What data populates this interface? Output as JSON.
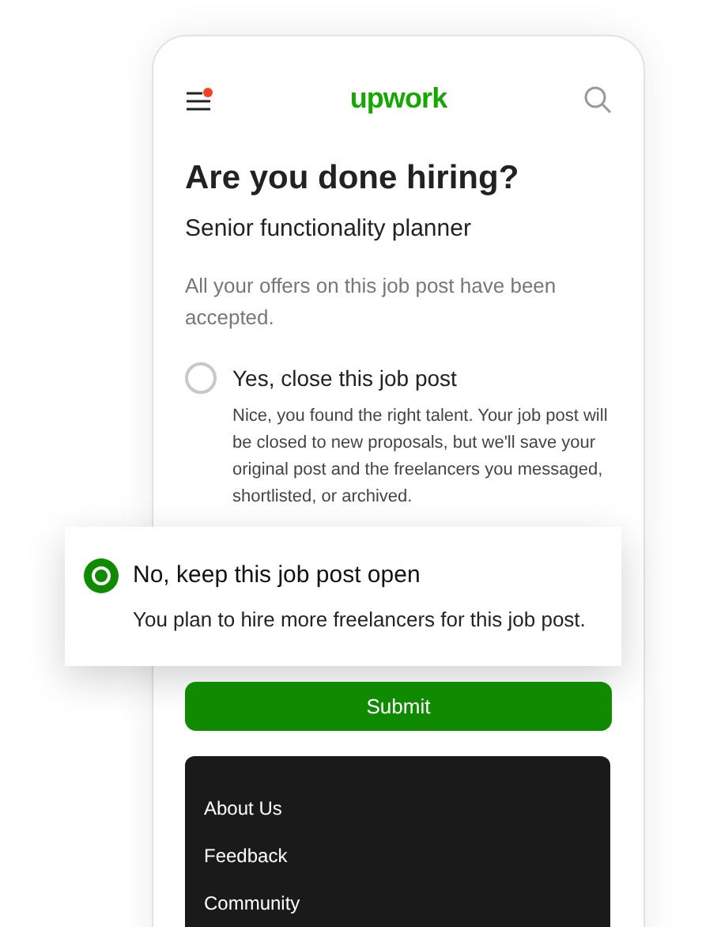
{
  "header": {
    "logo": "upwork",
    "menu_notification": true
  },
  "title": "Are you done hiring?",
  "job_title": "Senior functionality planner",
  "intro": "All your offers on this job post have been accepted.",
  "options": [
    {
      "label": "Yes, close this job post",
      "description": "Nice, you found the right talent. Your job post will be closed to new proposals, but we'll save your original post and the freelancers you messaged, shortlisted, or archived.",
      "selected": false
    },
    {
      "label": "No, keep this job post open",
      "description": "You plan to hire more freelancers for this job post.",
      "selected": true
    }
  ],
  "submit": "Submit",
  "footer_links": [
    "About Us",
    "Feedback",
    "Community"
  ]
}
